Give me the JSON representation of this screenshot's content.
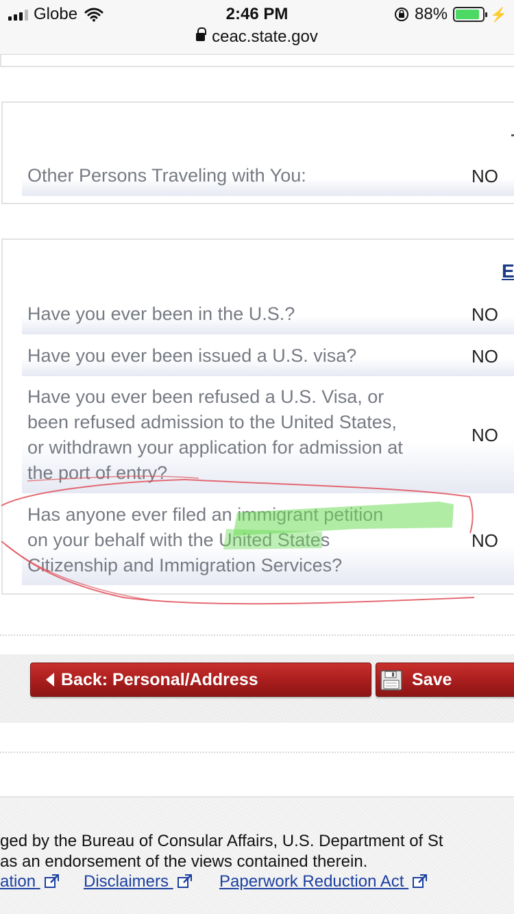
{
  "status_bar": {
    "carrier": "Globe",
    "time": "2:46 PM",
    "battery": "88%",
    "battery_level": 0.88,
    "url": "ceac.state.gov"
  },
  "sections": {
    "travel": {
      "rows": [
        {
          "question": "Other Persons Traveling with You:",
          "answer": "NO"
        }
      ]
    },
    "previous_travel": {
      "edit_label": "E",
      "rows": [
        {
          "question": "Have you ever been in the U.S.?",
          "answer": "NO"
        },
        {
          "question": "Have you ever been issued a U.S. visa?",
          "answer": "NO"
        },
        {
          "question_lines": [
            "Have you ever been refused a U.S. Visa, or",
            "been refused admission to the United States,",
            "or withdrawn your application for admission at",
            "the port of entry?"
          ],
          "answer": "NO"
        },
        {
          "question_lines": [
            "Has anyone ever filed an immigrant petition",
            "on your behalf with the United States",
            "Citizenship and Immigration Services?"
          ],
          "answer": "NO"
        }
      ]
    }
  },
  "buttons": {
    "back_label": "Back: Personal/Address",
    "save_label": "Save"
  },
  "footer": {
    "line1": "ged by the Bureau of Consular Affairs, U.S. Department of St",
    "line2": " as an endorsement of the views contained therein.",
    "links": [
      "ation",
      "Disclaimers",
      "Paperwork Reduction Act"
    ]
  },
  "colors": {
    "button_red": "#a81d1d",
    "link_blue": "#1b3fa0",
    "highlight_green": "#7be06a",
    "annotation_red": "#e0505a"
  },
  "icons": [
    "wifi-icon",
    "rotation-lock-icon",
    "battery-icon",
    "charging-bolt-icon",
    "padlock-icon",
    "back-arrow-icon",
    "save-floppy-icon",
    "external-link-icon"
  ]
}
